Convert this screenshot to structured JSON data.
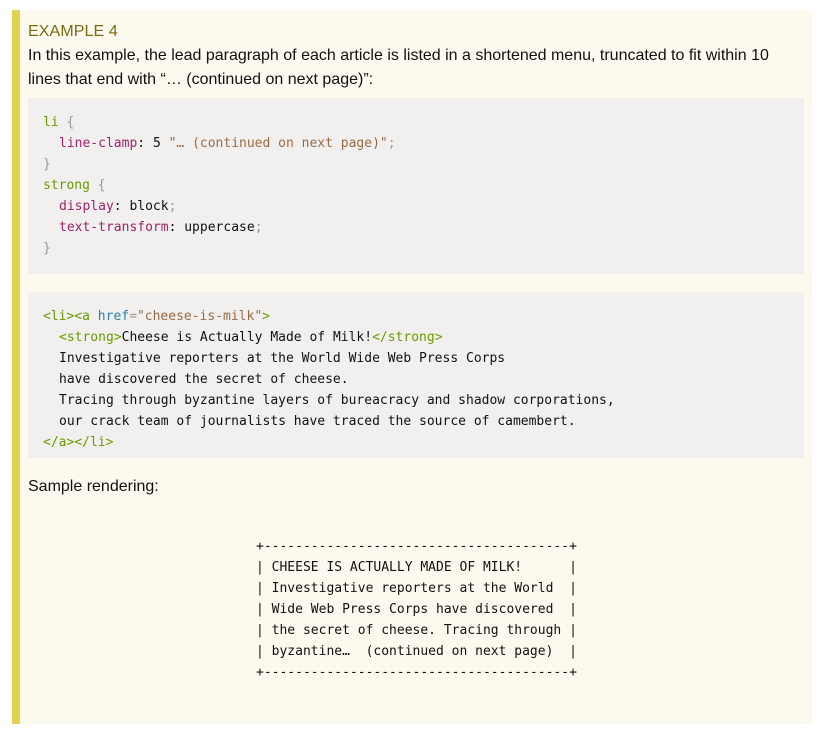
{
  "example": {
    "title": "EXAMPLE 4",
    "intro": "In this example, the lead paragraph of each article is listed in a shortened menu, truncated to fit within 10 lines that end with “… (continued on next page)”:",
    "css_code": {
      "li_selector": "li",
      "open_brace": " {",
      "close_brace": "}",
      "line_clamp_prop": "line-clamp",
      "colon_sep": ": ",
      "line_clamp_num": "5 ",
      "line_clamp_str": "\"… (continued on next page)\"",
      "semicolon": ";",
      "strong_selector": "strong",
      "display_prop": "display",
      "display_val": "block",
      "transform_prop": "text-transform",
      "transform_val": "uppercase"
    },
    "html_code": {
      "li_open": "<li>",
      "a_open_start": "<a ",
      "href_attr": "href",
      "eq": "=",
      "href_val": "\"cheese-is-milk\"",
      "a_open_end": ">",
      "strong_open": "<strong>",
      "strong_text": "Cheese is Actually Made of Milk!",
      "strong_close": "</strong>",
      "body_lines": [
        "Investigative reporters at the World Wide Web Press Corps",
        "have discovered the secret of cheese.",
        "Tracing through byzantine layers of bureacracy and shadow corporations,",
        "our crack team of journalists have traced the source of camembert."
      ],
      "a_close": "</a>",
      "li_close": "</li>"
    },
    "sample_label": "Sample rendering:",
    "sample_rendering": [
      "+---------------------------------------+",
      "| CHEESE IS ACTUALLY MADE OF MILK!      |",
      "| Investigative reporters at the World  |",
      "| Wide Web Press Corps have discovered  |",
      "| the secret of cheese. Tracing through |",
      "| byzantine…  (continued on next page)  |",
      "+---------------------------------------+"
    ]
  },
  "colors": {
    "background": "#fcfaee",
    "accent_border": "#e3d24f",
    "title": "#7b6a10",
    "code_background": "#f1f0ef"
  }
}
